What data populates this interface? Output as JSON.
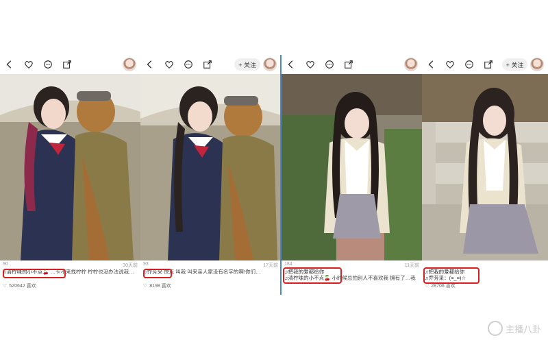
{
  "panels": [
    {
      "follow": "",
      "counter": "90",
      "time": "30天前",
      "tag1": "♫清柠味的小不点🍒",
      "caption": "…卡不来找柠柠 柠柠也没办法说我…",
      "likes": "520642 喜欢"
    },
    {
      "follow": "",
      "counter": "93",
      "time": "17天前",
      "tag1": "♫乔芳采",
      "caption": "快点 叫我 叫来亲人家没有名字的啊!你们…",
      "likes": "8198 喜欢"
    },
    {
      "follow": "",
      "counter": "184",
      "time": "11天前",
      "tag1": "♫把我的爱都给你",
      "tag2": "♫清柠味的小不点🍒",
      "caption": "小时候总怕别人不喜欢我 拥有了…我还是…",
      "likes": ""
    },
    {
      "follow": "",
      "counter": "",
      "time": "",
      "tag1": "♫把我的爱都给你",
      "tag2": "♫乔芳采：(=_=)☆",
      "caption": "",
      "likes": "28706 喜欢"
    }
  ],
  "follow_label": "+ 关注",
  "watermark": "主播八卦",
  "colors": {
    "highlight": "#d81e1e",
    "divider": "#4f86c6"
  }
}
